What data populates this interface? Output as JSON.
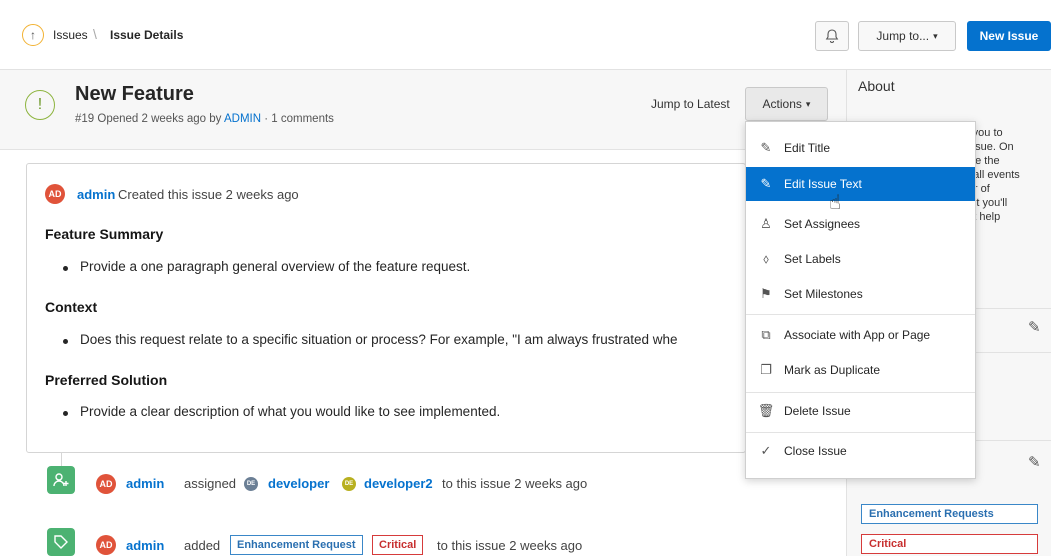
{
  "breadcrumb": {
    "parent": "Issues",
    "separator": "\\",
    "current": "Issue Details"
  },
  "topbar": {
    "jump_label": "Jump to...",
    "new_issue_label": "New Issue"
  },
  "issue": {
    "title": "New Feature",
    "number": "#19",
    "opened_text": "Opened 2 weeks ago by",
    "author_link": "ADMIN",
    "comments_text": "· 1 comments",
    "jump_latest": "Jump to Latest",
    "actions_label": "Actions"
  },
  "about": {
    "title": "About",
    "lines": [
      "es you to",
      "n issue. On",
      "l see the",
      "ng all events",
      "rder of",
      "right you'll",
      "that help"
    ]
  },
  "card": {
    "avatar": "AD",
    "user": "admin",
    "created_text": "Created this issue 2 weeks ago",
    "sections": [
      {
        "heading": "Feature Summary",
        "bullet": "Provide a one paragraph general overview of the feature request."
      },
      {
        "heading": "Context",
        "bullet": "Does this request relate to a specific situation or process? For example, \"I am always frustrated whe"
      },
      {
        "heading": "Preferred Solution",
        "bullet": "Provide a clear description of what you would like to see implemented."
      }
    ]
  },
  "timeline": [
    {
      "avatar": "AD",
      "user": "admin",
      "verb": "assigned",
      "assignee1_av": "DE",
      "assignee1": "developer",
      "assignee2_av": "DE",
      "assignee2": "developer2",
      "suffix": "to this issue 2 weeks ago"
    },
    {
      "avatar": "AD",
      "user": "admin",
      "verb": "added",
      "label1": "Enhancement Request",
      "label2": "Critical",
      "suffix": "to this issue 2 weeks ago"
    }
  ],
  "labels_panel": {
    "label1": "Enhancement Requests",
    "label2": "Critical"
  },
  "menu": {
    "items": [
      {
        "label": "Edit Title",
        "icon": "edit-icon"
      },
      {
        "label": "Edit Issue Text",
        "icon": "edit-icon"
      },
      {
        "label": "Set Assignees",
        "icon": "user-icon"
      },
      {
        "label": "Set Labels",
        "icon": "tag-icon"
      },
      {
        "label": "Set Milestones",
        "icon": "milestone-icon"
      },
      {
        "label": "Associate with App or Page",
        "icon": "link-icon"
      },
      {
        "label": "Mark as Duplicate",
        "icon": "duplicate-icon"
      },
      {
        "label": "Delete Issue",
        "icon": "trash-icon"
      },
      {
        "label": "Close Issue",
        "icon": "check-circle-icon"
      }
    ]
  },
  "colors": {
    "accent": "#0572ce",
    "avatar": "#e0533a",
    "timeline_icon": "#4cb272",
    "enhancement_tag": "#3a87c8",
    "critical_tag": "#d63b3b"
  }
}
